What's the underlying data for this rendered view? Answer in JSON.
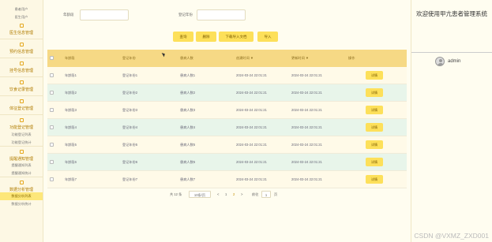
{
  "sidebar": {
    "top_items": [
      "患者用户",
      "医生用户"
    ],
    "groups": [
      {
        "label": "医生信息管理"
      },
      {
        "label": "预约信息管理"
      },
      {
        "label": "挂号信息管理"
      },
      {
        "label": "饮食记录管理"
      },
      {
        "label": "体征登记管理"
      },
      {
        "label": "功能登记管理",
        "children": [
          "功能登记列表",
          "功能登记统计"
        ]
      },
      {
        "label": "提醒通知管理",
        "children": [
          "提醒通知列表",
          "提醒通知统计"
        ]
      },
      {
        "label": "数据分析管理",
        "children": [
          "数据分析列表",
          "数据分析统计"
        ]
      }
    ]
  },
  "search": {
    "label1": "年龄段",
    "value1": "",
    "placeholder1": "",
    "label2": "登记年份",
    "value2": "",
    "placeholder2": ""
  },
  "toolbar": {
    "query": "查询",
    "delete": "删除",
    "export": "下载导入文档",
    "import": "导入"
  },
  "table": {
    "headers": [
      "年龄段",
      "登记年份",
      "患病人数",
      "创建时间 ▼",
      "更新时间 ▼",
      "操作"
    ],
    "rows": [
      [
        "年龄段1",
        "登记年份1",
        "患病人数1",
        "2024-03-24 22:01:21",
        "2024-03-24 22:01:21",
        "详情"
      ],
      [
        "年龄段2",
        "登记年份2",
        "患病人数2",
        "2024-03-24 22:01:21",
        "2024-03-24 22:01:21",
        "详情"
      ],
      [
        "年龄段3",
        "登记年份3",
        "患病人数3",
        "2024-03-24 22:01:21",
        "2024-03-24 22:01:21",
        "详情"
      ],
      [
        "年龄段4",
        "登记年份4",
        "患病人数4",
        "2024-03-24 22:01:21",
        "2024-03-24 22:01:21",
        "详情"
      ],
      [
        "年龄段5",
        "登记年份5",
        "患病人数5",
        "2024-03-24 22:01:21",
        "2024-03-24 22:01:21",
        "详情"
      ],
      [
        "年龄段6",
        "登记年份6",
        "患病人数6",
        "2024-03-24 22:01:21",
        "2024-03-24 22:01:21",
        "详情"
      ],
      [
        "年龄段7",
        "登记年份7",
        "患病人数7",
        "2024-03-24 22:01:21",
        "2024-03-24 22:01:21",
        "详情"
      ]
    ]
  },
  "pagination": {
    "total": "共 12 条",
    "page_size": "10条/页",
    "prev": "<",
    "page1": "1",
    "page2": "2",
    "next": ">",
    "goto_label": "前往",
    "goto_value": "1",
    "goto_suffix": "页"
  },
  "right_panel": {
    "welcome": "欢迎使用甲亢患者管理系统",
    "username": "admin"
  },
  "watermark": "CSDN @VXMZ_ZXD001",
  "colors": {
    "accent": "#fde05a",
    "header": "#f6d985",
    "row_alt": "#e8f5ea"
  }
}
